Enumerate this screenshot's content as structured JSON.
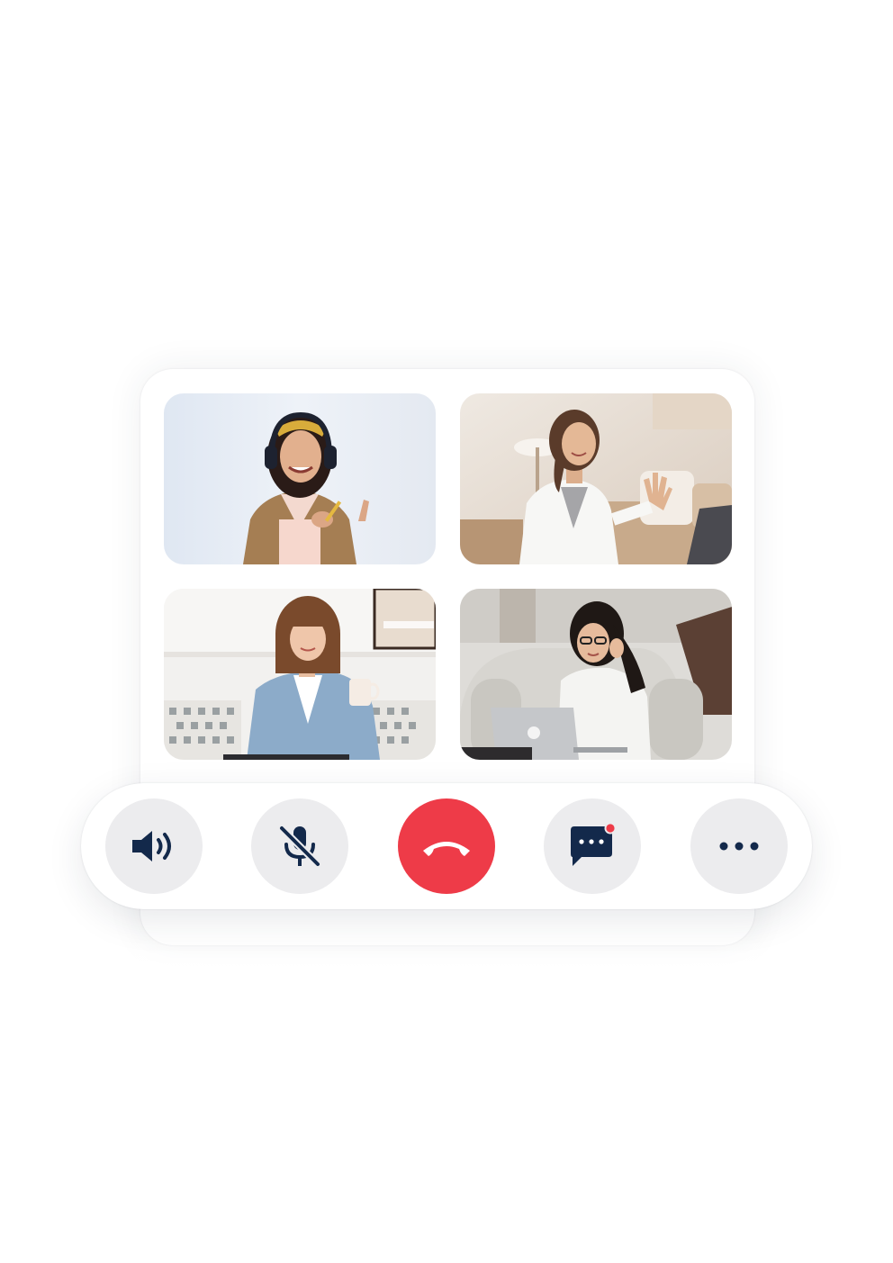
{
  "participants": [
    {
      "icon": "participant-video-headphones-woman"
    },
    {
      "icon": "participant-video-waving-woman"
    },
    {
      "icon": "participant-video-mug-woman"
    },
    {
      "icon": "participant-video-laptop-woman"
    }
  ],
  "controls": {
    "speaker": {
      "icon": "speaker-icon"
    },
    "mic": {
      "icon": "mic-off-icon",
      "muted": true
    },
    "hangup": {
      "icon": "hang-up-icon",
      "color": "#ee3b48"
    },
    "chat": {
      "icon": "chat-icon",
      "has_notification": true,
      "notification_color": "#ee3b48"
    },
    "more": {
      "icon": "more-icon"
    }
  },
  "colors": {
    "icon": "#13294b",
    "button_bg": "#ececee",
    "hangup_bg": "#ee3b48"
  }
}
